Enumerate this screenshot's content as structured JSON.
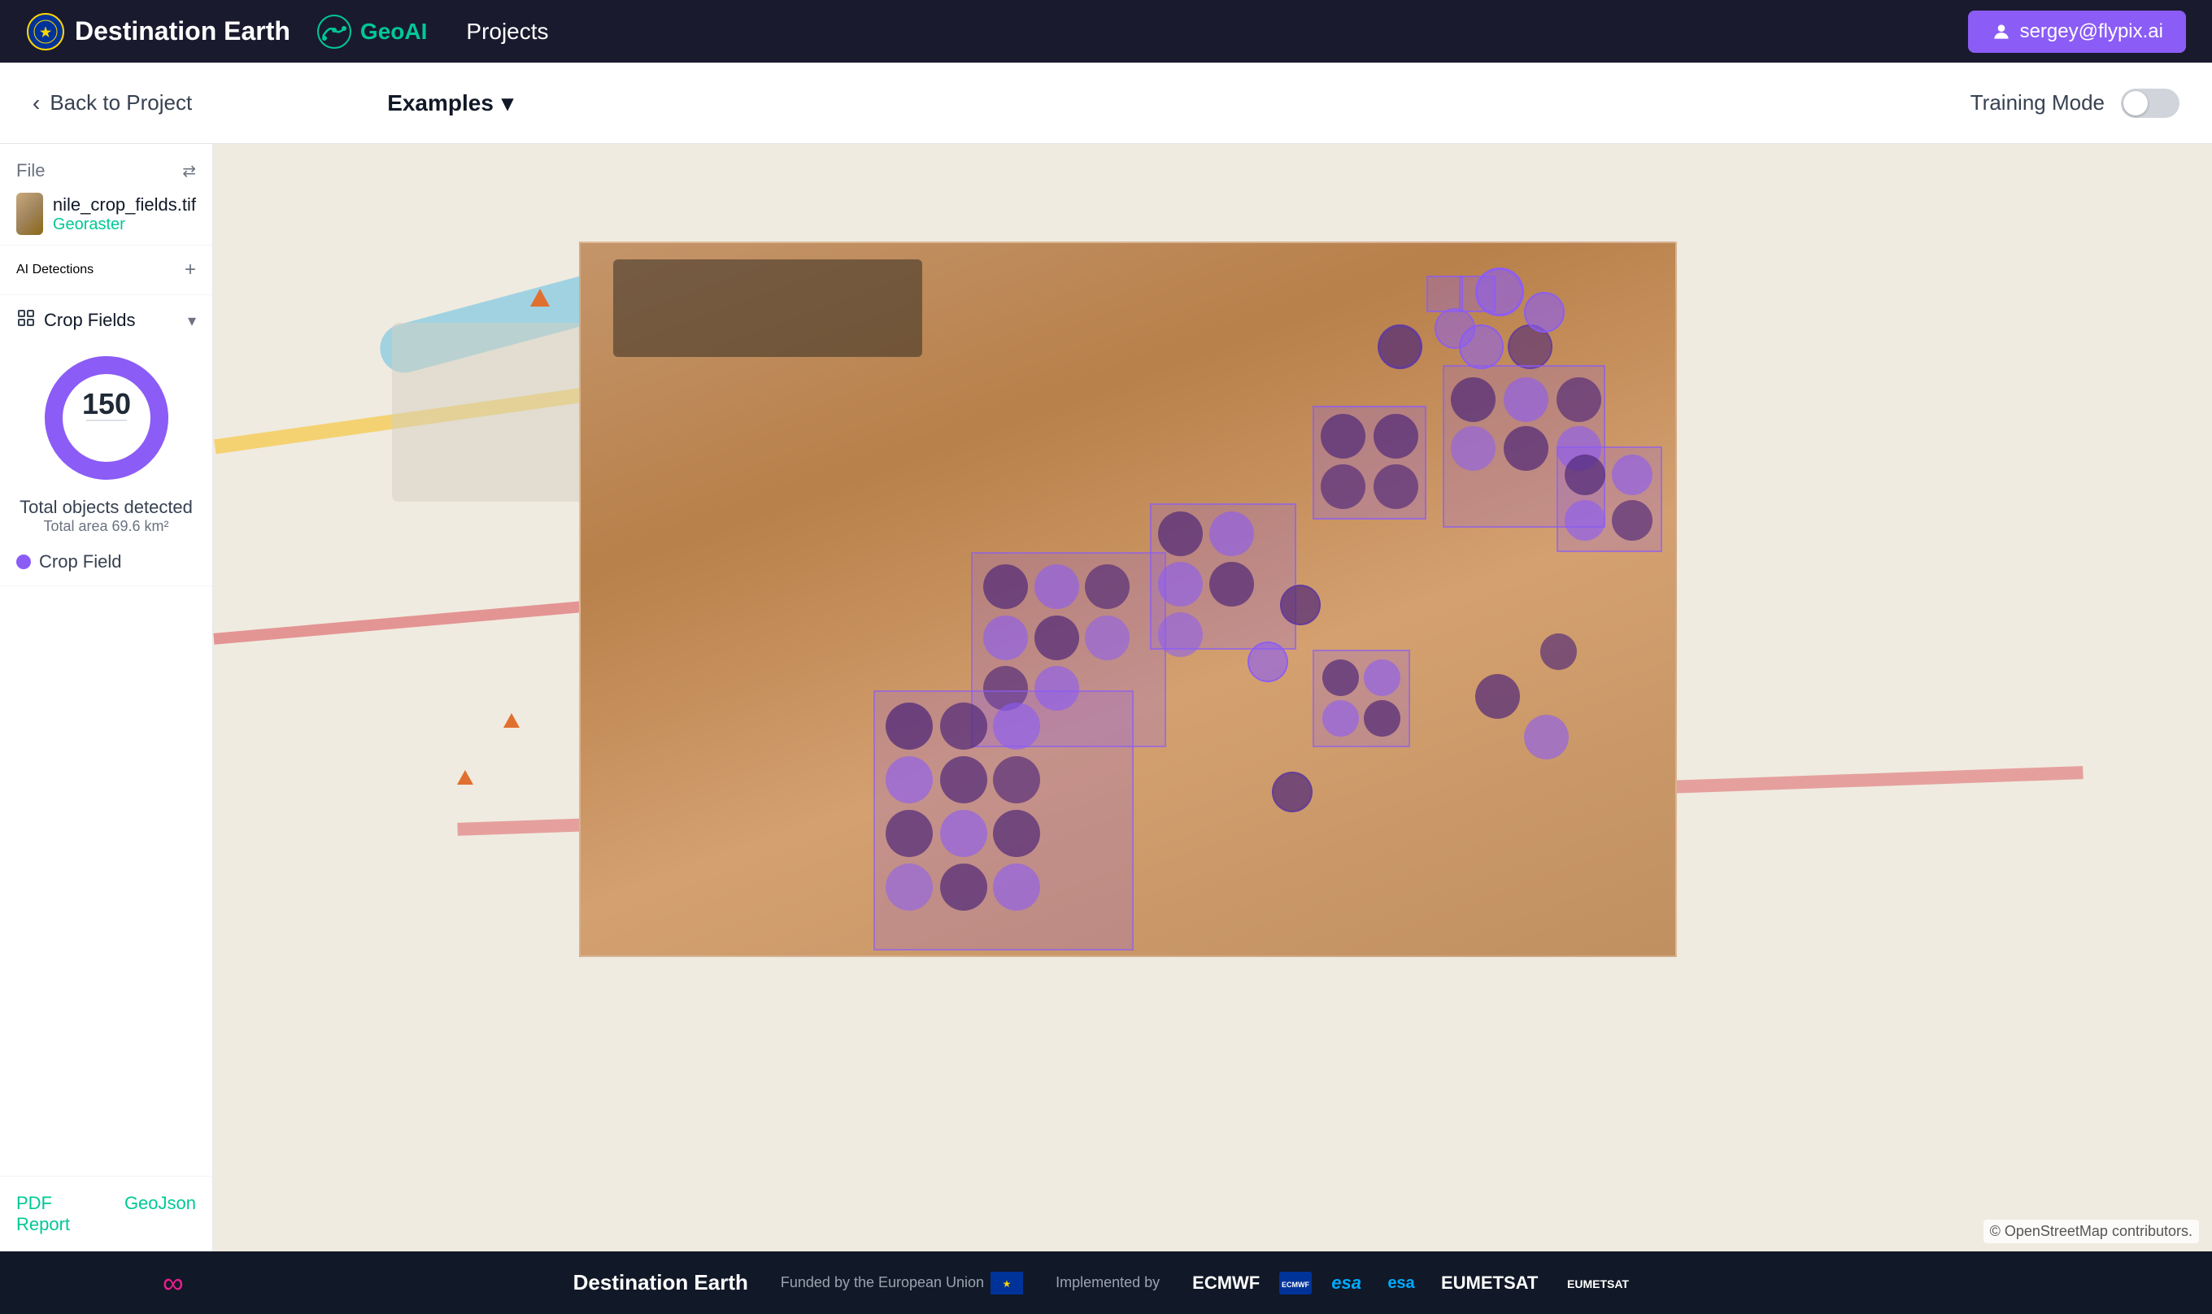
{
  "header": {
    "app_name": "Destination Earth",
    "geoai_label": "GeoAI",
    "projects_label": "Projects",
    "user_email": "sergey@flypix.ai"
  },
  "toolbar": {
    "back_label": "Back to Project",
    "examples_label": "Examples",
    "training_mode_label": "Training Mode"
  },
  "sidebar": {
    "file_label": "File",
    "file_name": "nile_crop_fields.tif",
    "file_type": "Georaster",
    "detections_label": "AI Detections",
    "crop_label": "Crop Fields",
    "total_objects": "150",
    "total_objects_label": "Total objects detected",
    "total_area_label": "Total area 69.6 km²",
    "legend_label": "Crop Field",
    "pdf_report": "PDF Report",
    "geojson": "GeoJson"
  },
  "map": {
    "attribution": "© OpenStreetMap contributors."
  },
  "footer": {
    "logo": "Destination Earth",
    "funded_by": "Funded by the European Union",
    "implemented_by": "Implemented by",
    "ecmwf": "ECMWF",
    "esa": "esa",
    "eumetsat": "EUMETSAT"
  }
}
